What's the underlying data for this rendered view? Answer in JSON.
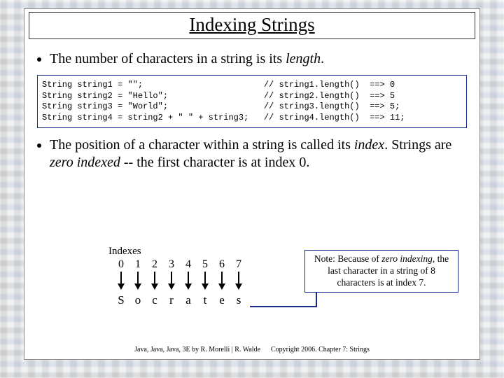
{
  "title": "Indexing Strings",
  "bullet1_pre": "The number of characters in a string is its ",
  "bullet1_em": "length",
  "bullet1_post": ".",
  "code": "String string1 = \"\";                        // string1.length()  ==> 0\nString string2 = \"Hello\";                   // string2.length()  ==> 5\nString string3 = \"World\";                   // string3.length()  ==> 5;\nString string4 = string2 + \" \" + string3;   // string4.length()  ==> 11;",
  "bullet2_a": "The position of a character within a string is called its ",
  "bullet2_b": "index",
  "bullet2_c": ". Strings are ",
  "bullet2_d": "zero indexed",
  "bullet2_e": " -- the first character is at index 0.",
  "diagram": {
    "label": "Indexes",
    "indexes": [
      "0",
      "1",
      "2",
      "3",
      "4",
      "5",
      "6",
      "7"
    ],
    "letters": [
      "S",
      "o",
      "c",
      "r",
      "a",
      "t",
      "e",
      "s"
    ]
  },
  "note_a": "Note: Because of ",
  "note_b": "zero indexing",
  "note_c": ", the last character in a string of 8 characters is at index 7.",
  "footer_left": "Java, Java, Java, 3E by R. Morelli | R. Walde",
  "footer_right": "Copyright 2006.  Chapter 7: Strings"
}
